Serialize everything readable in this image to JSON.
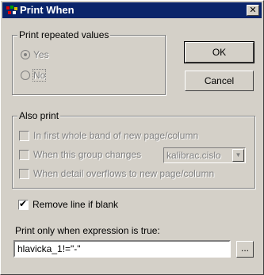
{
  "window": {
    "title": "Print When",
    "close_glyph": "✕"
  },
  "repeated_group": {
    "legend": "Print repeated values",
    "yes_label": "Yes",
    "no_label": "No",
    "selected": "Yes"
  },
  "buttons": {
    "ok_label": "OK",
    "cancel_label": "Cancel",
    "ellipsis_label": "..."
  },
  "also_print": {
    "legend": "Also print",
    "first_band_label": "In first whole band of new page/column",
    "group_changes_label": "When this group changes",
    "group_value": "kalibrac.cislo",
    "detail_overflow_label": "When detail overflows to new page/column"
  },
  "remove_line": {
    "label": "Remove line if blank",
    "checked": true
  },
  "expression": {
    "label": "Print only when expression is true:",
    "value": "hlavicka_1!=\"-\""
  },
  "colors": {
    "titlebar": "#0a246a",
    "face": "#d4d0c8",
    "disabled_text": "#808080"
  },
  "icons": {
    "app": "app-icon",
    "close": "close-icon",
    "dropdown": "chevron-down-icon"
  }
}
